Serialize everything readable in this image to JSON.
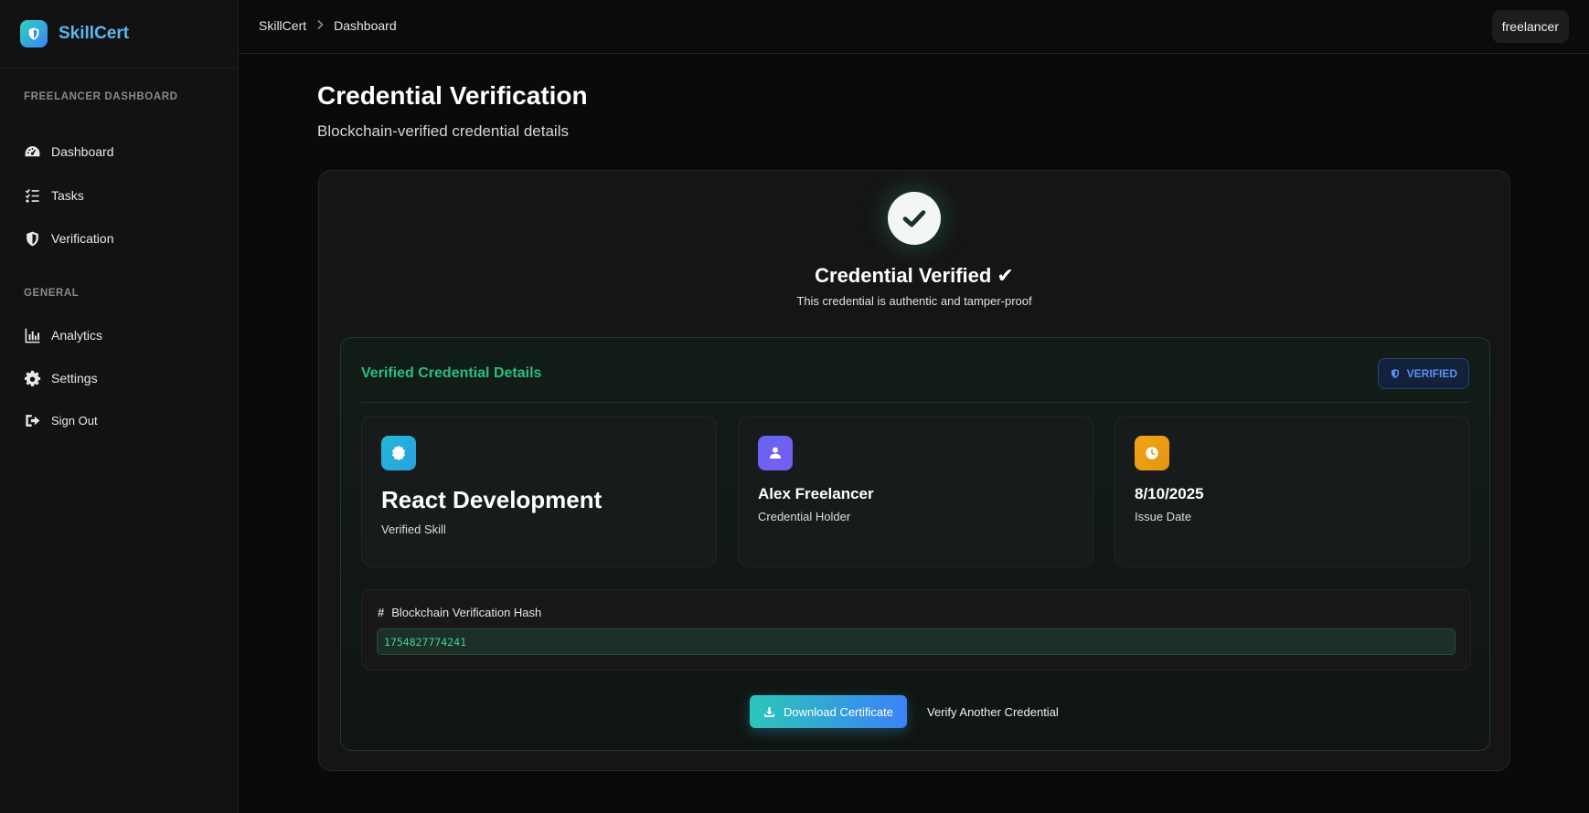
{
  "brand": {
    "name": "SkillCert"
  },
  "sidebar": {
    "section_main": "FREELANCER DASHBOARD",
    "items_main": [
      {
        "label": "Dashboard",
        "icon": "gauge-icon"
      },
      {
        "label": "Tasks",
        "icon": "checklist-icon"
      },
      {
        "label": "Verification",
        "icon": "shield-icon"
      }
    ],
    "section_general": "GENERAL",
    "items_general": [
      {
        "label": "Analytics",
        "icon": "bar-chart-icon"
      },
      {
        "label": "Settings",
        "icon": "gear-icon"
      },
      {
        "label": "Sign Out",
        "icon": "sign-out-icon"
      }
    ]
  },
  "topbar": {
    "breadcrumb": [
      "SkillCert",
      "Dashboard"
    ],
    "user": "freelancer"
  },
  "page": {
    "title": "Credential Verification",
    "subtitle": "Blockchain-verified credential details"
  },
  "verification": {
    "status_title": "Credential Verified ✔",
    "status_sub": "This credential is authentic and tamper-proof"
  },
  "details": {
    "title": "Verified Credential Details",
    "badge": "VERIFIED",
    "skill": {
      "value": "React Development",
      "label": "Verified Skill"
    },
    "holder": {
      "value": "Alex Freelancer",
      "label": "Credential Holder"
    },
    "issue_date": {
      "value": "8/10/2025",
      "label": "Issue Date"
    },
    "hash_label": "Blockchain Verification Hash",
    "hash_value": "1754827774241"
  },
  "actions": {
    "download": "Download Certificate",
    "verify_another": "Verify Another Credential"
  },
  "colors": {
    "brand_text": "#5ab8f0",
    "accent_green": "#27c07e",
    "badge_blue": "#5b8ff0",
    "skill_icon": "#22b8d8",
    "holder_icon": "#6366f1",
    "date_icon": "#f0a516"
  }
}
